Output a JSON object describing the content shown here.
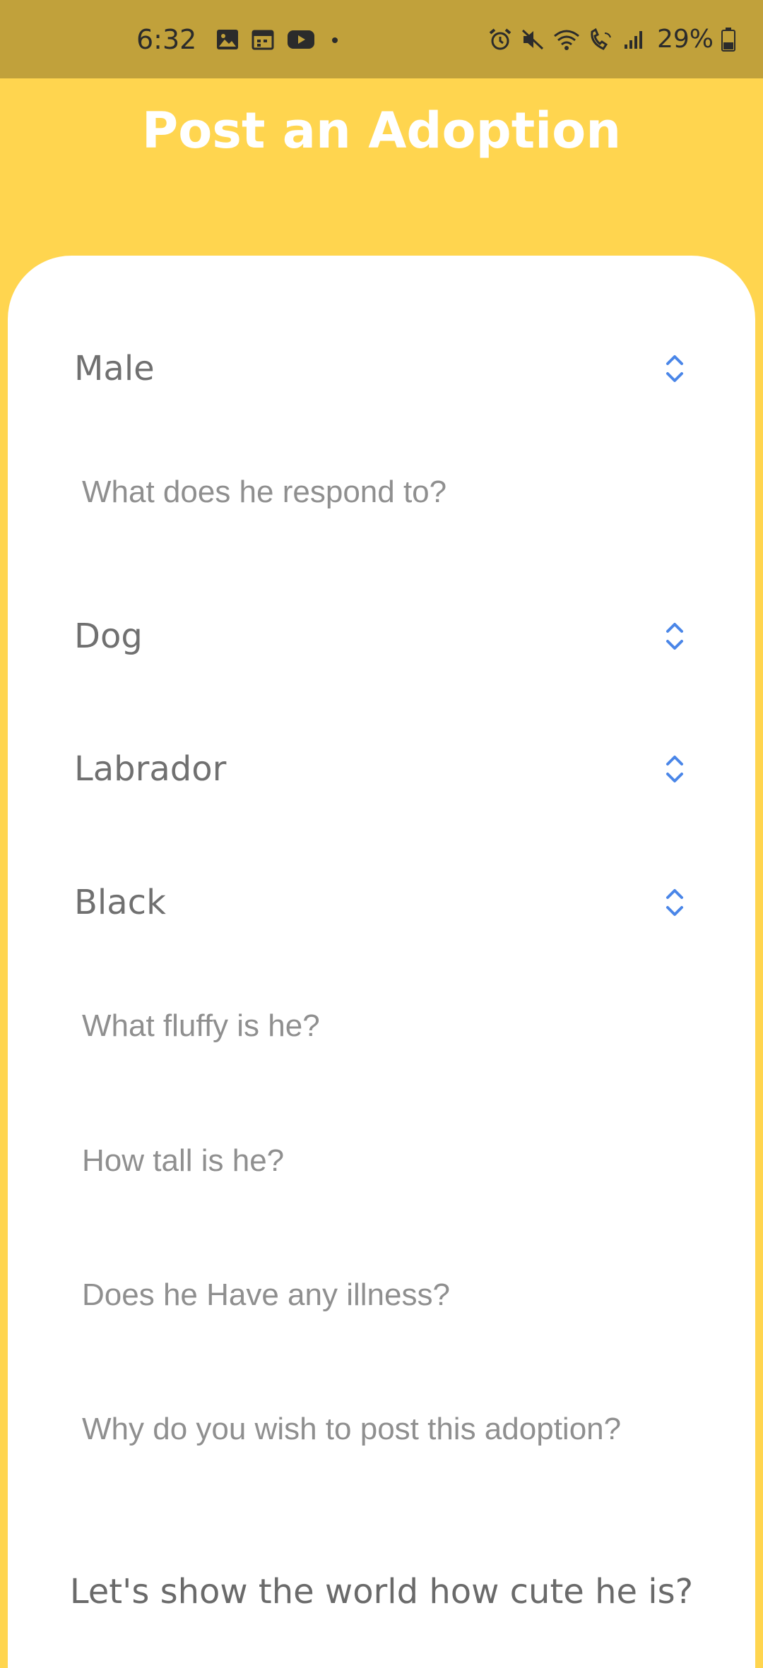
{
  "status_bar": {
    "time": "6:32",
    "battery_percent": "29%",
    "left_icons": [
      "gallery-icon",
      "calendar-icon",
      "youtube-icon",
      "notification-dot-icon"
    ],
    "right_icons": [
      "alarm-icon",
      "mute-icon",
      "wifi-icon",
      "wifi-calling-icon",
      "signal-icon",
      "battery-icon"
    ]
  },
  "header": {
    "title": "Post an Adoption"
  },
  "form": {
    "gender": {
      "value": "Male"
    },
    "name_field": {
      "placeholder": "What does he respond to?",
      "value": ""
    },
    "species": {
      "value": "Dog"
    },
    "breed": {
      "value": "Labrador"
    },
    "color": {
      "value": "Black"
    },
    "fluffiness_field": {
      "placeholder": "What fluffy is he?",
      "value": ""
    },
    "height_field": {
      "placeholder": "How tall is he?",
      "value": ""
    },
    "illness_field": {
      "placeholder": "Does he Have any illness?",
      "value": ""
    },
    "reason_field": {
      "placeholder": "Why do you wish to post this adoption?",
      "value": ""
    },
    "photo_prompt": "Let's show the world how cute he is?"
  },
  "colors": {
    "background": "#FFD54F",
    "status_bar": "#C1A13B",
    "card": "#FFFFFF",
    "accent_arrows": "#4A86E8",
    "select_text": "#707070",
    "placeholder_text": "#8F8F8F"
  }
}
